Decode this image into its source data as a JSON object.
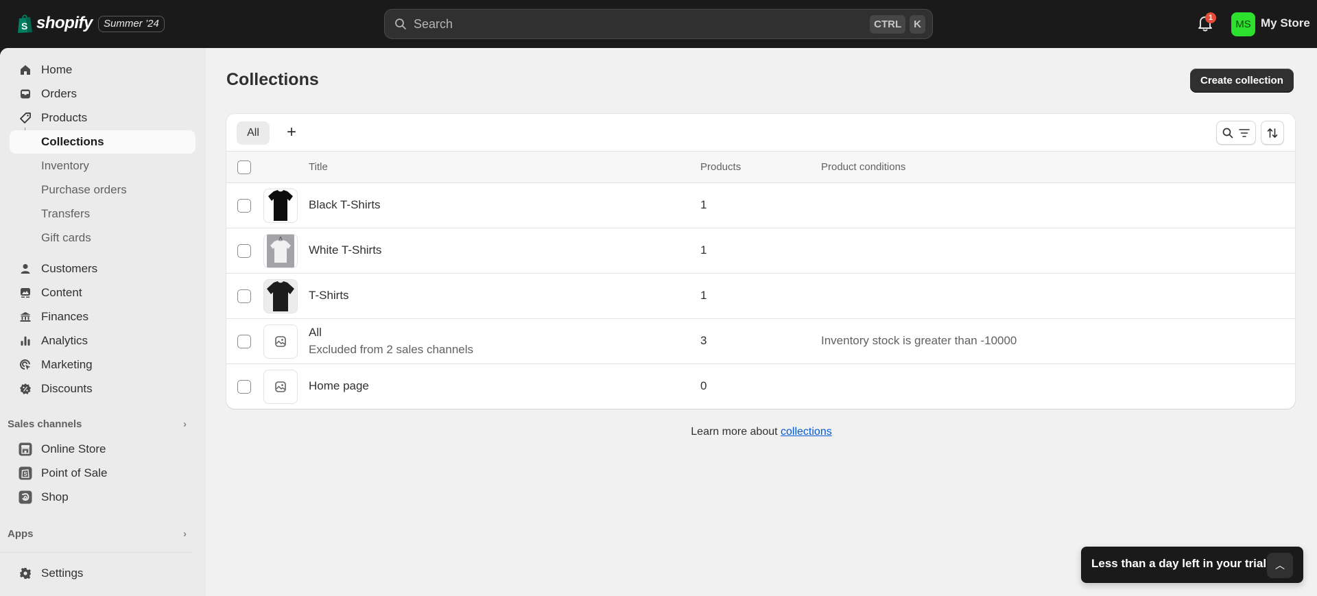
{
  "topbar": {
    "brand": "shopify",
    "edition_badge": "Summer ’24",
    "search_placeholder": "Search",
    "shortcut_keys": [
      "CTRL",
      "K"
    ],
    "notification_count": "1",
    "avatar_initials": "MS",
    "avatar_color": "#2ee02e",
    "store_name": "My Store"
  },
  "sidebar": {
    "items": [
      {
        "label": "Home",
        "icon": "home-icon"
      },
      {
        "label": "Orders",
        "icon": "inbox-icon"
      },
      {
        "label": "Products",
        "icon": "tag-icon"
      },
      {
        "label": "Collections",
        "active": true
      },
      {
        "label": "Inventory"
      },
      {
        "label": "Purchase orders"
      },
      {
        "label": "Transfers"
      },
      {
        "label": "Gift cards"
      },
      {
        "label": "Customers",
        "icon": "person-icon"
      },
      {
        "label": "Content",
        "icon": "content-icon"
      },
      {
        "label": "Finances",
        "icon": "bank-icon"
      },
      {
        "label": "Analytics",
        "icon": "bar-chart-icon"
      },
      {
        "label": "Marketing",
        "icon": "target-icon"
      },
      {
        "label": "Discounts",
        "icon": "discount-icon"
      }
    ],
    "sales_channels_label": "Sales channels",
    "sales_channels": [
      {
        "label": "Online Store",
        "icon": "store-icon"
      },
      {
        "label": "Point of Sale",
        "icon": "pos-icon"
      },
      {
        "label": "Shop",
        "icon": "shop-icon"
      }
    ],
    "apps_label": "Apps",
    "settings_label": "Settings"
  },
  "main": {
    "title": "Collections",
    "create_button": "Create collection",
    "tabs": [
      {
        "label": "All",
        "selected": true
      }
    ],
    "add_tab": "+",
    "columns": {
      "title": "Title",
      "products": "Products",
      "conditions": "Product conditions"
    },
    "rows": [
      {
        "title": "Black T-Shirts",
        "subtitle": "",
        "products": "1",
        "conditions": "",
        "thumb": "black-tshirt"
      },
      {
        "title": "White T-Shirts",
        "subtitle": "",
        "products": "1",
        "conditions": "",
        "thumb": "white-tshirt"
      },
      {
        "title": "T-Shirts",
        "subtitle": "",
        "products": "1",
        "conditions": "",
        "thumb": "black-tshirt-2"
      },
      {
        "title": "All",
        "subtitle": "Excluded from 2 sales channels",
        "products": "3",
        "conditions": "Inventory stock is greater than -10000",
        "thumb": "placeholder"
      },
      {
        "title": "Home page",
        "subtitle": "",
        "products": "0",
        "conditions": "",
        "thumb": "placeholder"
      }
    ],
    "learn_more_prefix": "Learn more about ",
    "learn_more_link": "collections",
    "link_color": "#005bd3"
  },
  "trial_banner": {
    "text": "Less than a day left in your trial"
  }
}
